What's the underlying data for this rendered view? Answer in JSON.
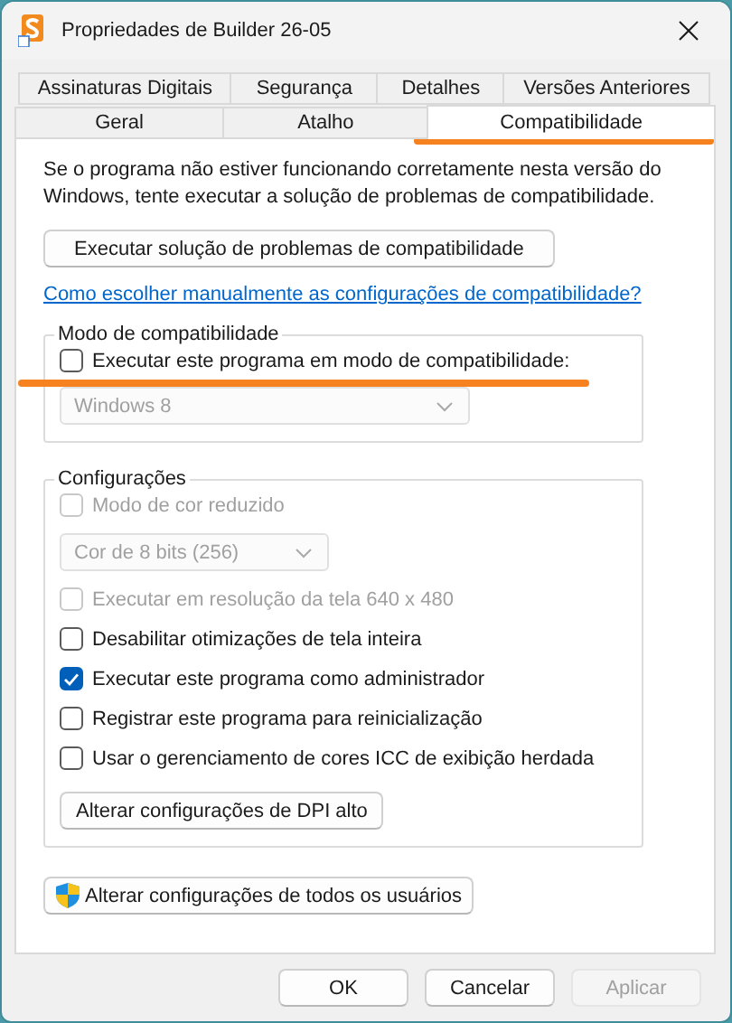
{
  "window": {
    "title": "Propriedades de Builder 26-05"
  },
  "tab_rows": [
    [
      {
        "label": "Assinaturas Digitais",
        "selected": false
      },
      {
        "label": "Segurança",
        "selected": false
      },
      {
        "label": "Detalhes",
        "selected": false
      },
      {
        "label": "Versões Anteriores",
        "selected": false
      }
    ],
    [
      {
        "label": "Geral",
        "selected": false
      },
      {
        "label": "Atalho",
        "selected": false
      },
      {
        "label": "Compatibilidade",
        "selected": true
      }
    ]
  ],
  "intro": "Se o programa não estiver funcionando corretamente nesta versão do Windows, tente executar a solução de problemas de compatibilidade.",
  "troubleshoot_button": "Executar solução de problemas de compatibilidade",
  "manual_link": "Como escolher manualmente as configurações de compatibilidade?",
  "compat_mode": {
    "legend": "Modo de compatibilidade",
    "checkbox": {
      "label": "Executar este programa em modo de compatibilidade:",
      "checked": false,
      "disabled": false
    },
    "dropdown": {
      "value": "Windows 8",
      "disabled": true
    }
  },
  "settings": {
    "legend": "Configurações",
    "items": [
      {
        "kind": "checkbox",
        "label": "Modo de cor reduzido",
        "checked": false,
        "disabled": true
      },
      {
        "kind": "dropdown",
        "value": "Cor de 8 bits (256)",
        "disabled": true
      },
      {
        "kind": "checkbox",
        "label": "Executar em resolução da tela 640 x 480",
        "checked": false,
        "disabled": true
      },
      {
        "kind": "checkbox",
        "label": "Desabilitar otimizações de tela inteira",
        "checked": false,
        "disabled": false
      },
      {
        "kind": "checkbox",
        "label": "Executar este programa como administrador",
        "checked": true,
        "disabled": false
      },
      {
        "kind": "checkbox",
        "label": "Registrar este programa para reinicialização",
        "checked": false,
        "disabled": false
      },
      {
        "kind": "checkbox",
        "label": "Usar o gerenciamento de cores ICC de exibição herdada",
        "checked": false,
        "disabled": false
      }
    ],
    "dpi_button": "Alterar configurações de DPI alto"
  },
  "all_users_button": "Alterar configurações de todos os usuários",
  "buttons": [
    {
      "label": "OK",
      "disabled": false
    },
    {
      "label": "Cancelar",
      "disabled": false
    },
    {
      "label": "Aplicar",
      "disabled": true
    }
  ]
}
